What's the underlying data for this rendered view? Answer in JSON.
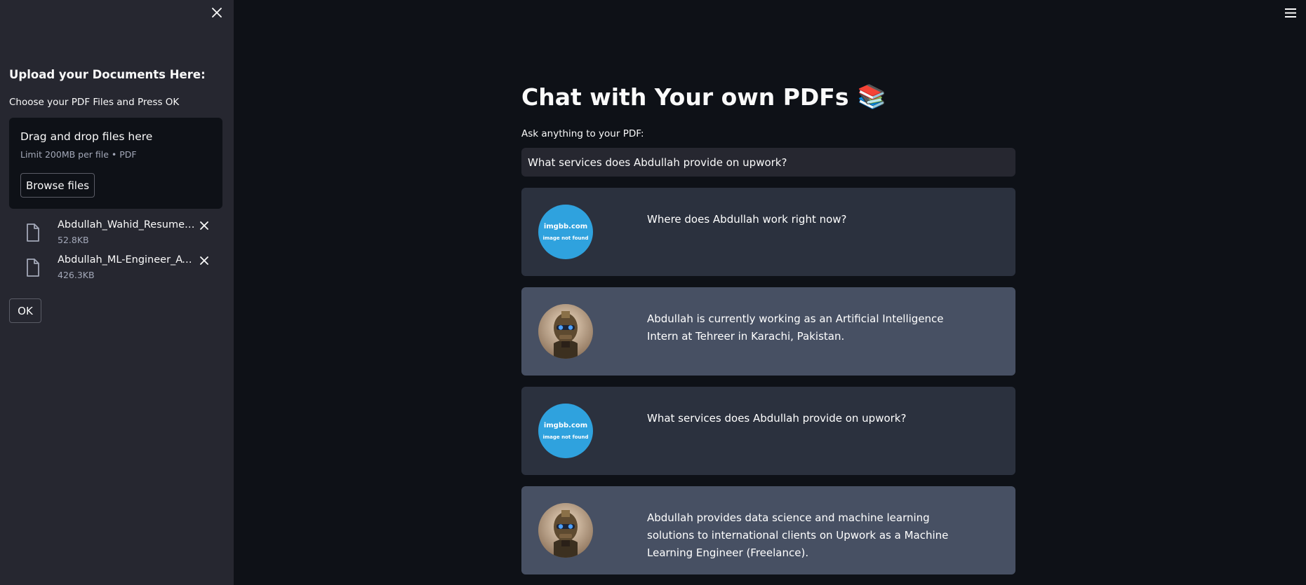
{
  "sidebar": {
    "title": "Upload your Documents Here:",
    "uploader_label": "Choose your PDF Files and Press OK",
    "dropzone": {
      "title": "Drag and drop files here",
      "limit": "Limit 200MB per file • PDF",
      "browse_label": "Browse files"
    },
    "files": [
      {
        "name": "Abdullah_Wahid_Resume_…",
        "size": "52.8KB"
      },
      {
        "name": "Abdullah_ML-Engineer_ATS…",
        "size": "426.3KB"
      }
    ],
    "ok_label": "OK"
  },
  "main": {
    "title": "Chat with Your own PDFs",
    "title_emoji": "📚",
    "input_label": "Ask anything to your PDF:",
    "input_value": "What services does Abdullah provide on upwork?",
    "placeholder_avatar": {
      "line1": "imgbb.com",
      "line2": "image not found"
    },
    "messages": [
      {
        "role": "user",
        "text": "Where does Abdullah work right now?"
      },
      {
        "role": "bot",
        "text": "Abdullah is currently working as an Artificial Intelligence Intern at Tehreer in Karachi, Pakistan."
      },
      {
        "role": "user",
        "text": "What services does Abdullah provide on upwork?"
      },
      {
        "role": "bot",
        "text": "Abdullah provides data science and machine learning solutions to international clients on Upwork as a Machine Learning Engineer (Freelance)."
      }
    ]
  },
  "colors": {
    "background": "#0e1117",
    "sidebar": "#262730",
    "user_message": "#2b313e",
    "bot_message": "#475063",
    "placeholder_avatar": "#2fa2de"
  }
}
